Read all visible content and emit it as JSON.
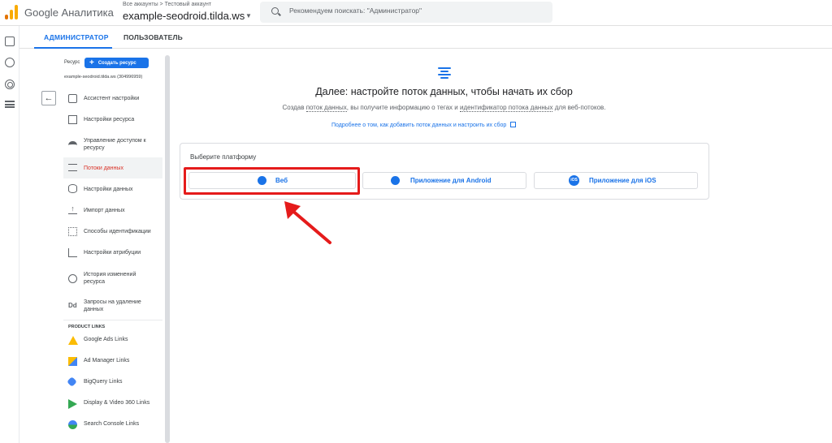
{
  "header": {
    "app_name": "Google Аналитика",
    "account_breadcrumb": "Все аккаунты > Тестовый аккаунт",
    "account_name": "example-seodroid.tilda.ws",
    "search_placeholder": "Рекомендуем поискать: \"Администратор\""
  },
  "tabs": [
    {
      "label": "АДМИНИСТРАТОР",
      "active": true
    },
    {
      "label": "ПОЛЬЗОВАТЕЛЬ",
      "active": false
    }
  ],
  "sidebar": {
    "resource_label": "Ресурс",
    "create_button": "Создать ресурс",
    "property_name": "example-seodroid.tilda.ws (304996959)",
    "items": [
      {
        "label": "Ассистент настройки",
        "icon": "checkbox-icon"
      },
      {
        "label": "Настройки ресурса",
        "icon": "window-icon"
      },
      {
        "label": "Управление доступом к ресурсу",
        "icon": "people-icon"
      },
      {
        "label": "Потоки данных",
        "icon": "stream-icon",
        "active": true
      },
      {
        "label": "Настройки данных",
        "icon": "database-icon"
      },
      {
        "label": "Импорт данных",
        "icon": "upload-icon"
      },
      {
        "label": "Способы идентификации",
        "icon": "identity-icon"
      },
      {
        "label": "Настройки атрибуции",
        "icon": "attribution-icon"
      },
      {
        "label": "История изменений ресурса",
        "icon": "history-icon"
      },
      {
        "label": "Запросы на удаление данных",
        "icon": "dd-icon"
      }
    ],
    "links_header": "PRODUCT LINKS",
    "links": [
      {
        "label": "Google Ads Links",
        "icon": "google-ads-icon"
      },
      {
        "label": "Ad Manager Links",
        "icon": "ad-manager-icon"
      },
      {
        "label": "BigQuery Links",
        "icon": "bigquery-icon"
      },
      {
        "label": "Display & Video 360 Links",
        "icon": "dv360-icon"
      },
      {
        "label": "Search Console Links",
        "icon": "search-console-icon"
      }
    ]
  },
  "main": {
    "title": "Далее: настройте поток данных, чтобы начать их сбор",
    "subtitle_part1": "Создав ",
    "subtitle_link1": "поток данных",
    "subtitle_part2": ", вы получите информацию о тегах и ",
    "subtitle_link2": "идентификатор потока данных",
    "subtitle_part3": " для веб-потоков.",
    "learn_more": "Подробнее о том, как добавить поток данных и настроить их сбор",
    "platform_label": "Выберите платформу",
    "platforms": [
      {
        "label": "Веб",
        "icon": "globe-icon"
      },
      {
        "label": "Приложение для Android",
        "icon": "android-icon"
      },
      {
        "label": "Приложение для iOS",
        "icon": "ios-icon",
        "icon_text": "iOS"
      }
    ]
  },
  "colors": {
    "accent": "#1a73e8",
    "highlight": "#e51b1b",
    "active_text": "#d93025"
  }
}
